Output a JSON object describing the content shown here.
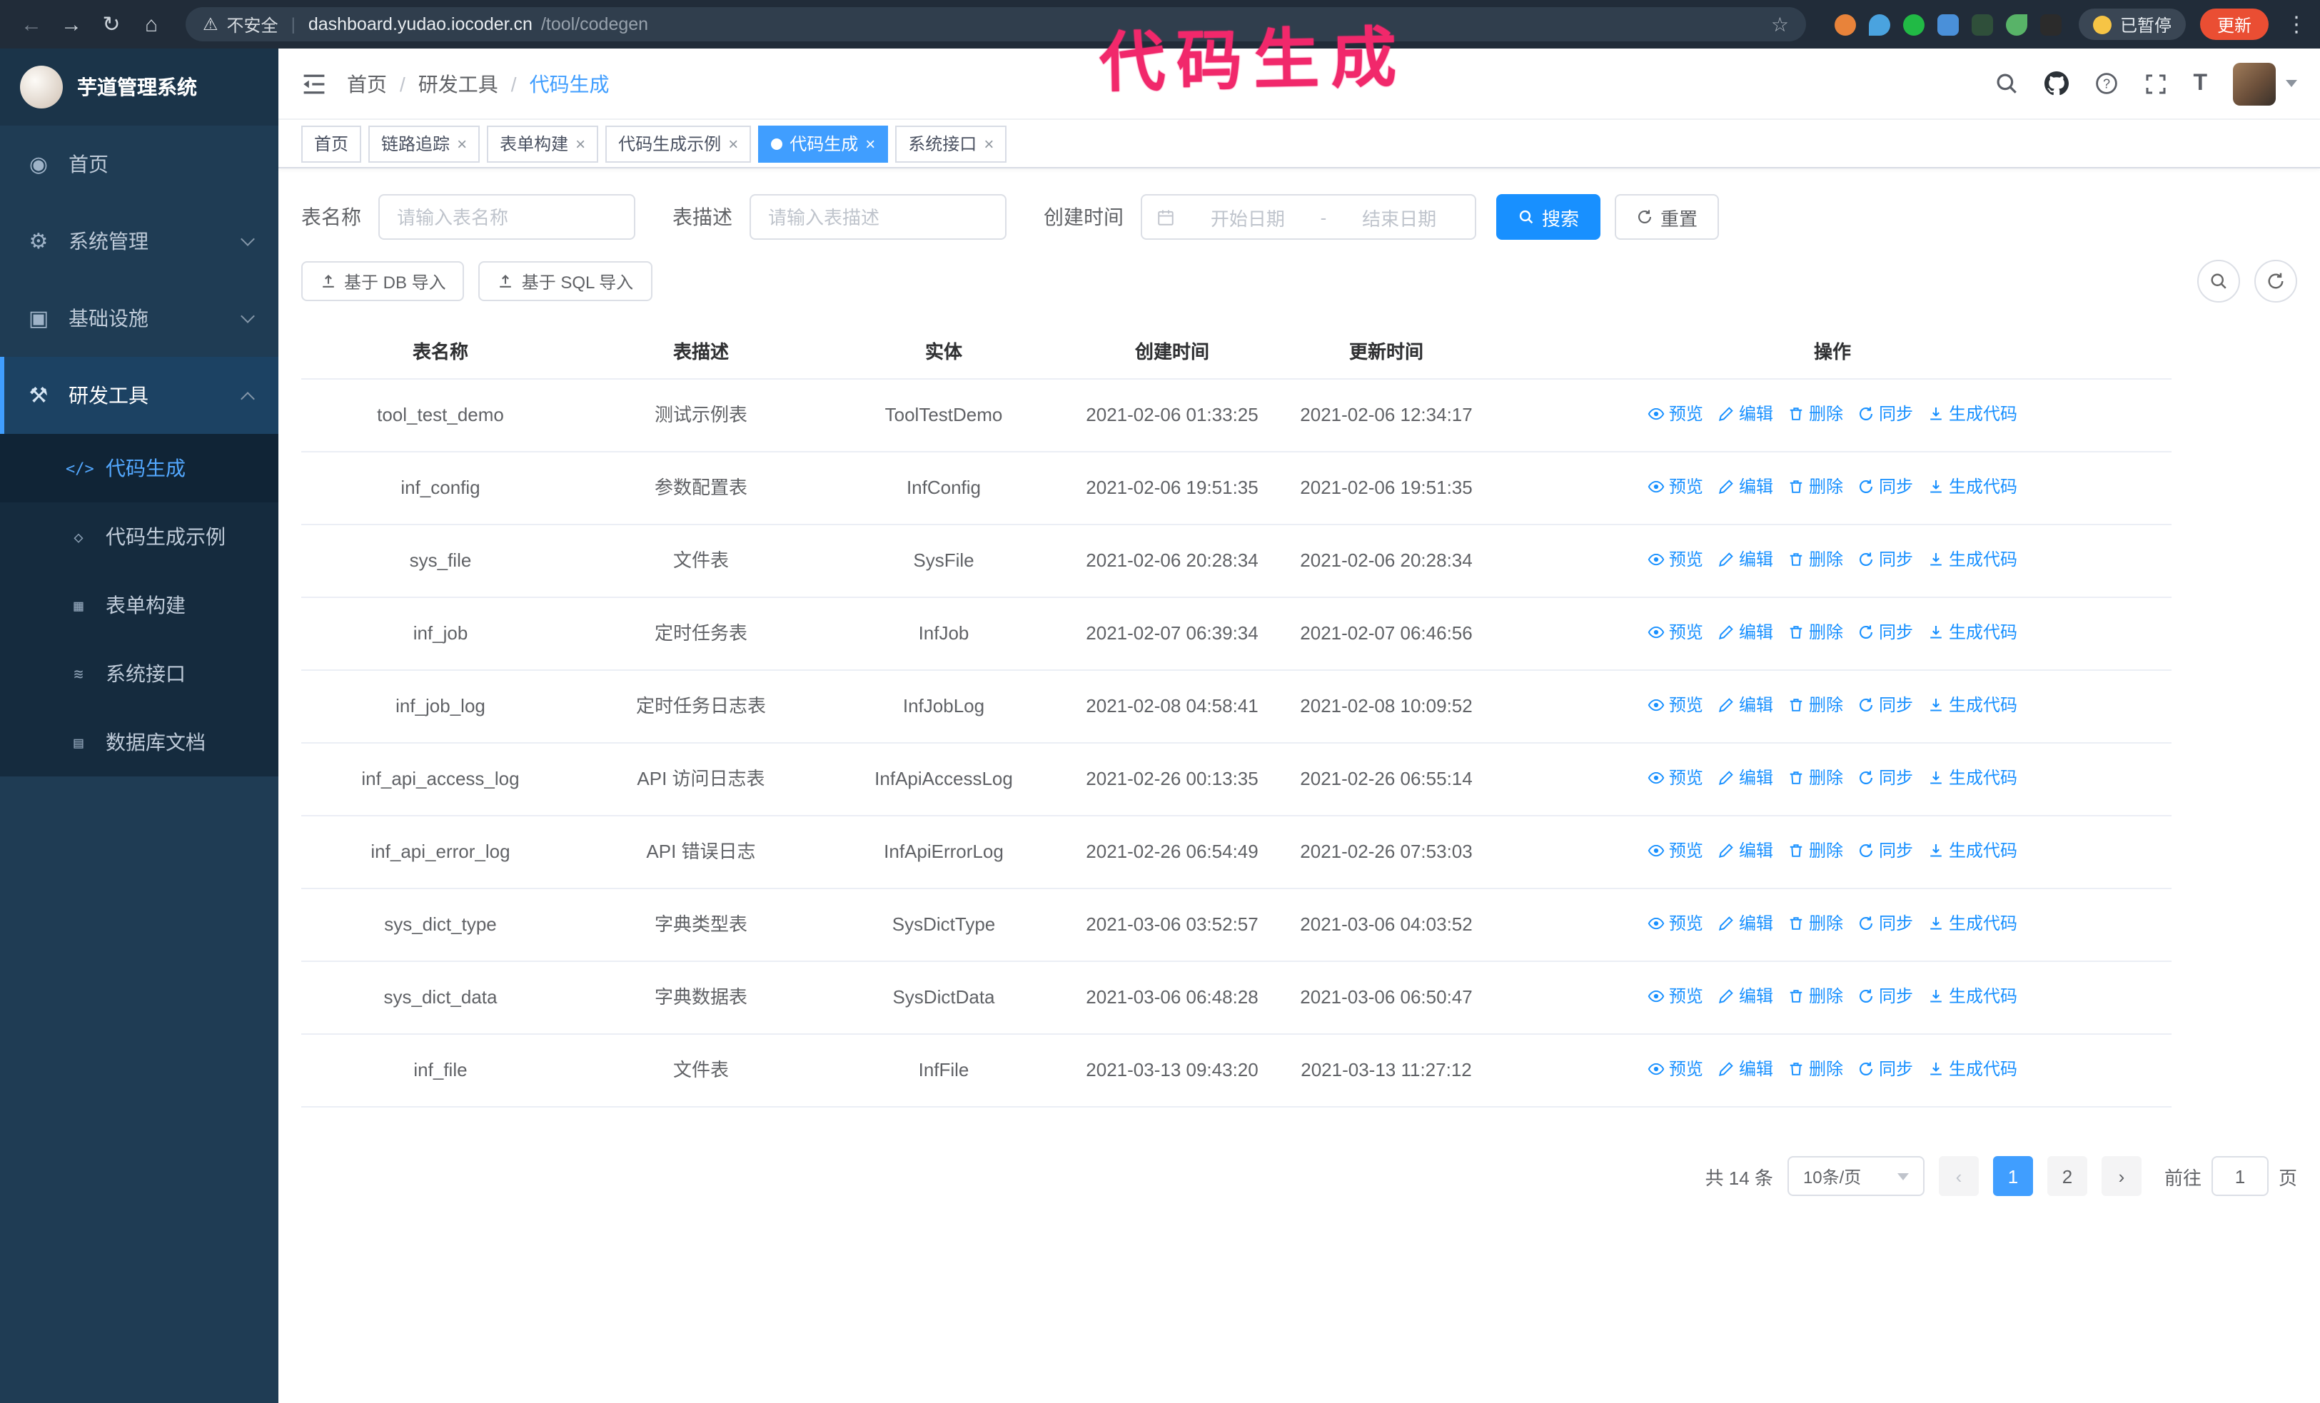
{
  "icons": {
    "back": "←",
    "forward": "→",
    "reload": "↻",
    "home": "⌂",
    "warning": "⚠",
    "star": "☆",
    "menu_dots": "⋮",
    "close": "×",
    "divider": "|",
    "prev": "‹",
    "next": "›",
    "font_size": "T",
    "help_mark": "?",
    "menu_home": "◉",
    "menu_system": "⚙",
    "menu_infra": "▣",
    "menu_dev": "⚒",
    "sub_codegen": "</>",
    "sub_demo": "◇",
    "sub_form": "▦",
    "sub_api": "≋",
    "sub_db": "▤"
  },
  "browser": {
    "security_text": "不安全",
    "url_host": "dashboard.yudao.iocoder.cn",
    "url_path": "/tool/codegen",
    "paused_label": "已暂停",
    "update_label": "更新"
  },
  "annotation": {
    "text": "代码生成",
    "color": "#f1286b"
  },
  "sidebar": {
    "title": "芋道管理系统",
    "items": [
      {
        "label": "首页"
      },
      {
        "label": "系统管理"
      },
      {
        "label": "基础设施"
      },
      {
        "label": "研发工具"
      }
    ],
    "sub_items": [
      {
        "label": "代码生成"
      },
      {
        "label": "代码生成示例"
      },
      {
        "label": "表单构建"
      },
      {
        "label": "系统接口"
      },
      {
        "label": "数据库文档"
      }
    ]
  },
  "header": {
    "breadcrumb": [
      "首页",
      "研发工具",
      "代码生成"
    ],
    "separator": "/"
  },
  "tabs": {
    "items": [
      {
        "label": "首页",
        "closable": false,
        "active": false
      },
      {
        "label": "链路追踪",
        "closable": true,
        "active": false
      },
      {
        "label": "表单构建",
        "closable": true,
        "active": false
      },
      {
        "label": "代码生成示例",
        "closable": true,
        "active": false
      },
      {
        "label": "代码生成",
        "closable": true,
        "active": true
      },
      {
        "label": "系统接口",
        "closable": true,
        "active": false
      }
    ]
  },
  "filters": {
    "table_name_label": "表名称",
    "table_name_placeholder": "请输入表名称",
    "table_desc_label": "表描述",
    "table_desc_placeholder": "请输入表描述",
    "create_time_label": "创建时间",
    "date_start_placeholder": "开始日期",
    "date_separator": "-",
    "date_end_placeholder": "结束日期",
    "search_label": "搜索",
    "reset_label": "重置"
  },
  "toolbar": {
    "import_db_label": "基于 DB 导入",
    "import_sql_label": "基于 SQL 导入"
  },
  "table": {
    "columns": [
      "表名称",
      "表描述",
      "实体",
      "创建时间",
      "更新时间",
      "操作"
    ],
    "actions": [
      "预览",
      "编辑",
      "删除",
      "同步",
      "生成代码"
    ],
    "rows": [
      {
        "name": "tool_test_demo",
        "desc": "测试示例表",
        "entity": "ToolTestDemo",
        "created": "2021-02-06 01:33:25",
        "updated": "2021-02-06 12:34:17",
        "created_wrap": false,
        "updated_wrap": false
      },
      {
        "name": "inf_config",
        "desc": "参数配置表",
        "entity": "InfConfig",
        "created": "2021-02-06 19:51:35",
        "updated": "2021-02-06 19:51:35",
        "created_wrap": false,
        "updated_wrap": false
      },
      {
        "name": "sys_file",
        "desc": "文件表",
        "entity": "SysFile",
        "created": "2021-02-06 20:28:34",
        "updated": "2021-02-06 20:28:34",
        "created_wrap": true,
        "updated_wrap": true
      },
      {
        "name": "inf_job",
        "desc": "定时任务表",
        "entity": "InfJob",
        "created": "2021-02-07 06:39:34",
        "updated": "2021-02-07 06:46:56",
        "created_wrap": true,
        "updated_wrap": true
      },
      {
        "name": "inf_job_log",
        "desc": "定时任务日志表",
        "entity": "InfJobLog",
        "created": "2021-02-08 04:58:41",
        "updated": "2021-02-08 10:09:52",
        "created_wrap": true,
        "updated_wrap": true
      },
      {
        "name": "inf_api_access_log",
        "desc": "API 访问日志表",
        "entity": "InfApiAccessLog",
        "created": "2021-02-26 00:13:35",
        "updated": "2021-02-26 06:55:14",
        "created_wrap": false,
        "updated_wrap": true
      },
      {
        "name": "inf_api_error_log",
        "desc": "API 错误日志",
        "entity": "InfApiErrorLog",
        "created": "2021-02-26 06:54:49",
        "updated": "2021-02-26 07:53:03",
        "created_wrap": true,
        "updated_wrap": true
      },
      {
        "name": "sys_dict_type",
        "desc": "字典类型表",
        "entity": "SysDictType",
        "created": "2021-03-06 03:52:57",
        "updated": "2021-03-06 04:03:52",
        "created_wrap": true,
        "updated_wrap": true
      },
      {
        "name": "sys_dict_data",
        "desc": "字典数据表",
        "entity": "SysDictData",
        "created": "2021-03-06 06:48:28",
        "updated": "2021-03-06 06:50:47",
        "created_wrap": true,
        "updated_wrap": true
      },
      {
        "name": "inf_file",
        "desc": "文件表",
        "entity": "InfFile",
        "created": "2021-03-13 09:43:20",
        "updated": "2021-03-13 11:27:12",
        "created_wrap": true,
        "updated_wrap": false
      }
    ]
  },
  "pagination": {
    "total": "共 14 条",
    "page_size": "10条/页",
    "pages": [
      "1",
      "2"
    ],
    "active_page": "1",
    "goto_prefix": "前往",
    "goto_value": "1",
    "goto_suffix": "页"
  }
}
